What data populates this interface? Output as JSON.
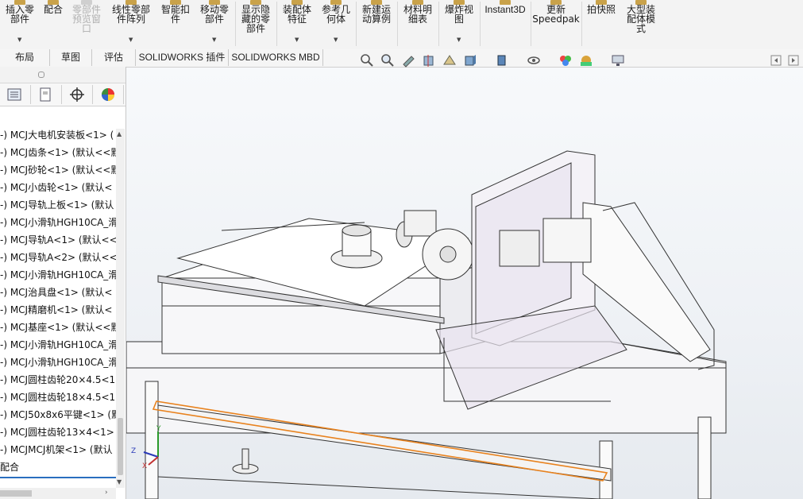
{
  "ribbon": {
    "buttons": [
      {
        "label": "插入零\n部件",
        "disabled": false
      },
      {
        "label": "配合",
        "disabled": false
      },
      {
        "label": "零部件\n预览窗\n口",
        "disabled": true
      },
      {
        "label": "线性零部\n件阵列",
        "disabled": false
      },
      {
        "label": "智能扣\n件",
        "disabled": false
      },
      {
        "label": "移动零\n部件",
        "disabled": false
      },
      {
        "label": "显示隐\n藏的零\n部件",
        "disabled": false
      },
      {
        "label": "装配体\n特征",
        "disabled": false
      },
      {
        "label": "参考几\n何体",
        "disabled": false
      },
      {
        "label": "新建运\n动算例",
        "disabled": false
      },
      {
        "label": "材料明\n细表",
        "disabled": false
      },
      {
        "label": "爆炸视\n图",
        "disabled": false
      },
      {
        "label": "Instant3D",
        "disabled": false
      },
      {
        "label": "更新\nSpeedpak",
        "disabled": false
      },
      {
        "label": "拍快照",
        "disabled": false
      },
      {
        "label": "大型装\n配体模\n式",
        "disabled": false
      }
    ]
  },
  "tabs": [
    "布局",
    "草图",
    "评估",
    "SOLIDWORKS 插件",
    "SOLIDWORKS MBD"
  ],
  "tree": {
    "items": [
      "-) MCJ大电机安装板<1> (",
      "-) MCJ齿条<1> (默认<<默",
      "-) MCJ砂轮<1> (默认<<默",
      "-) MCJ小齿轮<1> (默认<",
      "-) MCJ导轨上板<1> (默认",
      "-) MCJ小滑轨HGH10CA_滑",
      "-) MCJ导轨A<1> (默认<<",
      "-) MCJ导轨A<2> (默认<<",
      "-) MCJ小滑轨HGH10CA_滑",
      "-) MCJ治具盘<1> (默认<",
      "-) MCJ精磨机<1> (默认<",
      "-) MCJ基座<1> (默认<<默",
      "-) MCJ小滑轨HGH10CA_滑",
      "-) MCJ小滑轨HGH10CA_滑",
      "-) MCJ圆柱齿轮20×4.5<1",
      "-) MCJ圆柱齿轮18×4.5<1",
      "-) MCJ50x8x6平键<1> (默",
      "-) MCJ圆柱齿轮13×4<1>",
      "-) MCJMCJ机架<1> (默认"
    ],
    "footer": "配合"
  },
  "triad": {
    "y": "Y",
    "z": "Z",
    "x": "X"
  },
  "colors": {
    "selection": "#e8821e",
    "accent": "#2a6ebf"
  }
}
